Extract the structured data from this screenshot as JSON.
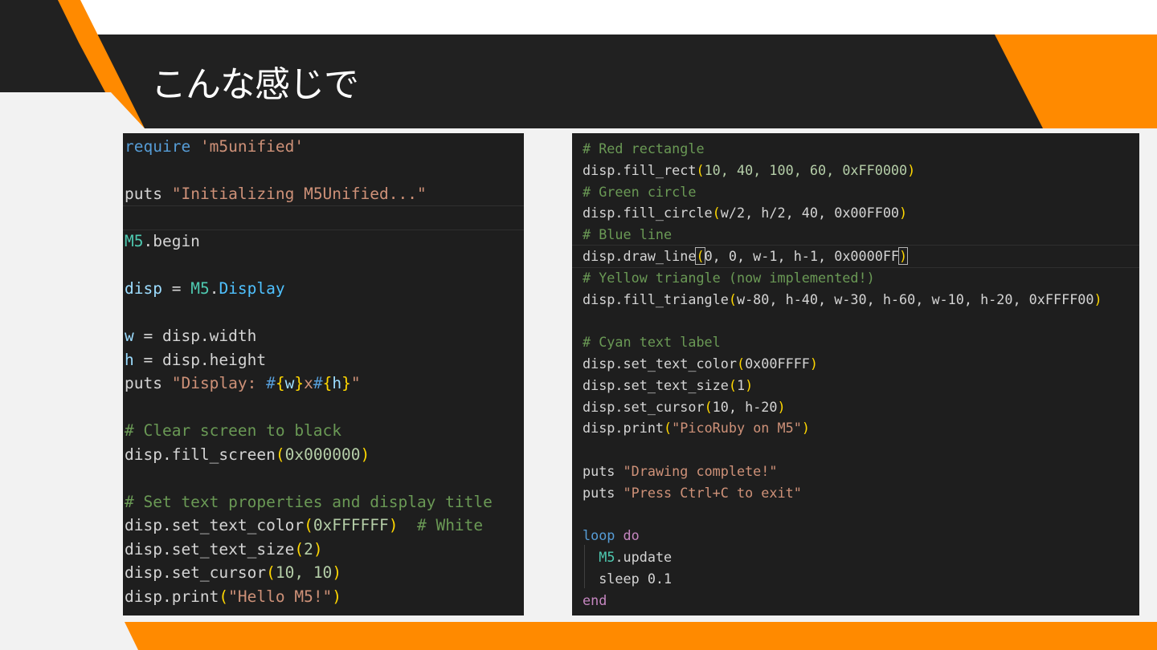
{
  "slide": {
    "title": "こんな感じで",
    "colors": {
      "accent": "#ff8a00",
      "header": "#212121",
      "editor_bg": "#1e1e1e"
    }
  },
  "left_code": [
    [
      [
        "require",
        "kw"
      ],
      [
        " ",
        "plain"
      ],
      [
        "'m5unified'",
        "str"
      ]
    ],
    [],
    [
      [
        "puts",
        "plain"
      ],
      [
        " ",
        "plain"
      ],
      [
        "\"Initializing M5Unified...\"",
        "str"
      ]
    ],
    [],
    [
      [
        "M5",
        "cls"
      ],
      [
        ".begin",
        "plain"
      ]
    ],
    [],
    [
      [
        "disp",
        "var"
      ],
      [
        " = ",
        "plain"
      ],
      [
        "M5",
        "cls"
      ],
      [
        ".",
        "plain"
      ],
      [
        "Display",
        "prop"
      ]
    ],
    [],
    [
      [
        "w",
        "var"
      ],
      [
        " = disp.width",
        "plain"
      ]
    ],
    [
      [
        "h",
        "var"
      ],
      [
        " = disp.height",
        "plain"
      ]
    ],
    [
      [
        "puts",
        "plain"
      ],
      [
        " ",
        "plain"
      ],
      [
        "\"Display: ",
        "str"
      ],
      [
        "#",
        "kw"
      ],
      [
        "{",
        "br"
      ],
      [
        "w",
        "var"
      ],
      [
        "}",
        "br"
      ],
      [
        "x",
        "str"
      ],
      [
        "#",
        "kw"
      ],
      [
        "{",
        "br"
      ],
      [
        "h",
        "var"
      ],
      [
        "}",
        "br"
      ],
      [
        "\"",
        "str"
      ]
    ],
    [],
    [
      [
        "# Clear screen to black",
        "cmt"
      ]
    ],
    [
      [
        "disp.fill_screen",
        "plain"
      ],
      [
        "(",
        "br"
      ],
      [
        "0x000000",
        "num"
      ],
      [
        ")",
        "br"
      ]
    ],
    [],
    [
      [
        "# Set text properties and display title",
        "cmt"
      ]
    ],
    [
      [
        "disp.set_text_color",
        "plain"
      ],
      [
        "(",
        "br"
      ],
      [
        "0xFFFFFF",
        "num"
      ],
      [
        ")",
        "br"
      ],
      [
        "  ",
        "plain"
      ],
      [
        "# White",
        "cmt"
      ]
    ],
    [
      [
        "disp.set_text_size",
        "plain"
      ],
      [
        "(",
        "br"
      ],
      [
        "2",
        "num"
      ],
      [
        ")",
        "br"
      ]
    ],
    [
      [
        "disp.set_cursor",
        "plain"
      ],
      [
        "(",
        "br"
      ],
      [
        "10, 10",
        "num"
      ],
      [
        ")",
        "br"
      ]
    ],
    [
      [
        "disp.print",
        "plain"
      ],
      [
        "(",
        "br"
      ],
      [
        "\"Hello M5!\"",
        "str"
      ],
      [
        ")",
        "br"
      ]
    ]
  ],
  "right_code": [
    [
      [
        "# Red rectangle",
        "cmt"
      ]
    ],
    [
      [
        "disp.fill_rect",
        "plain"
      ],
      [
        "(",
        "br"
      ],
      [
        "10, 40, 100, 60, 0xFF0000",
        "num"
      ],
      [
        ")",
        "br"
      ]
    ],
    [
      [
        "# Green circle",
        "cmt"
      ]
    ],
    [
      [
        "disp.fill_circle",
        "plain"
      ],
      [
        "(",
        "br"
      ],
      [
        "w/2, h/2, 40, 0x00FF00",
        "plain"
      ],
      [
        ")",
        "br"
      ]
    ],
    [
      [
        "# Blue line",
        "cmt"
      ]
    ],
    [
      [
        "disp.draw_line",
        "plain"
      ],
      [
        "(",
        "brhl"
      ],
      [
        "0, 0, w-1, h-1, 0x0000FF",
        "plain"
      ],
      [
        ")",
        "brhl"
      ]
    ],
    [
      [
        "# Yellow triangle (now implemented!)",
        "cmt"
      ]
    ],
    [
      [
        "disp.fill_triangle",
        "plain"
      ],
      [
        "(",
        "br"
      ],
      [
        "w-80, h-40, w-30, h-60, w-10, h-20, 0xFFFF00",
        "plain"
      ],
      [
        ")",
        "br"
      ]
    ],
    [],
    [
      [
        "# Cyan text label",
        "cmt"
      ]
    ],
    [
      [
        "disp.set_text_color",
        "plain"
      ],
      [
        "(",
        "br"
      ],
      [
        "0x00FFFF",
        "plain"
      ],
      [
        ")",
        "br"
      ]
    ],
    [
      [
        "disp.set_text_size",
        "plain"
      ],
      [
        "(",
        "br"
      ],
      [
        "1",
        "plain"
      ],
      [
        ")",
        "br"
      ]
    ],
    [
      [
        "disp.set_cursor",
        "plain"
      ],
      [
        "(",
        "br"
      ],
      [
        "10, h-20",
        "plain"
      ],
      [
        ")",
        "br"
      ]
    ],
    [
      [
        "disp.print",
        "plain"
      ],
      [
        "(",
        "br"
      ],
      [
        "\"PicoRuby on M5\"",
        "str"
      ],
      [
        ")",
        "br"
      ]
    ],
    [],
    [
      [
        "puts",
        "plain"
      ],
      [
        " ",
        "plain"
      ],
      [
        "\"Drawing complete!\"",
        "str"
      ]
    ],
    [
      [
        "puts",
        "plain"
      ],
      [
        " ",
        "plain"
      ],
      [
        "\"Press Ctrl+C to exit\"",
        "str"
      ]
    ],
    [],
    [
      [
        "loop",
        "kw"
      ],
      [
        " ",
        "plain"
      ],
      [
        "do",
        "kw2"
      ]
    ],
    [
      [
        "  ",
        "plain"
      ],
      [
        "M5",
        "cls"
      ],
      [
        ".update",
        "plain"
      ]
    ],
    [
      [
        "  sleep 0.1",
        "plain"
      ]
    ],
    [
      [
        "end",
        "kw2"
      ]
    ]
  ]
}
